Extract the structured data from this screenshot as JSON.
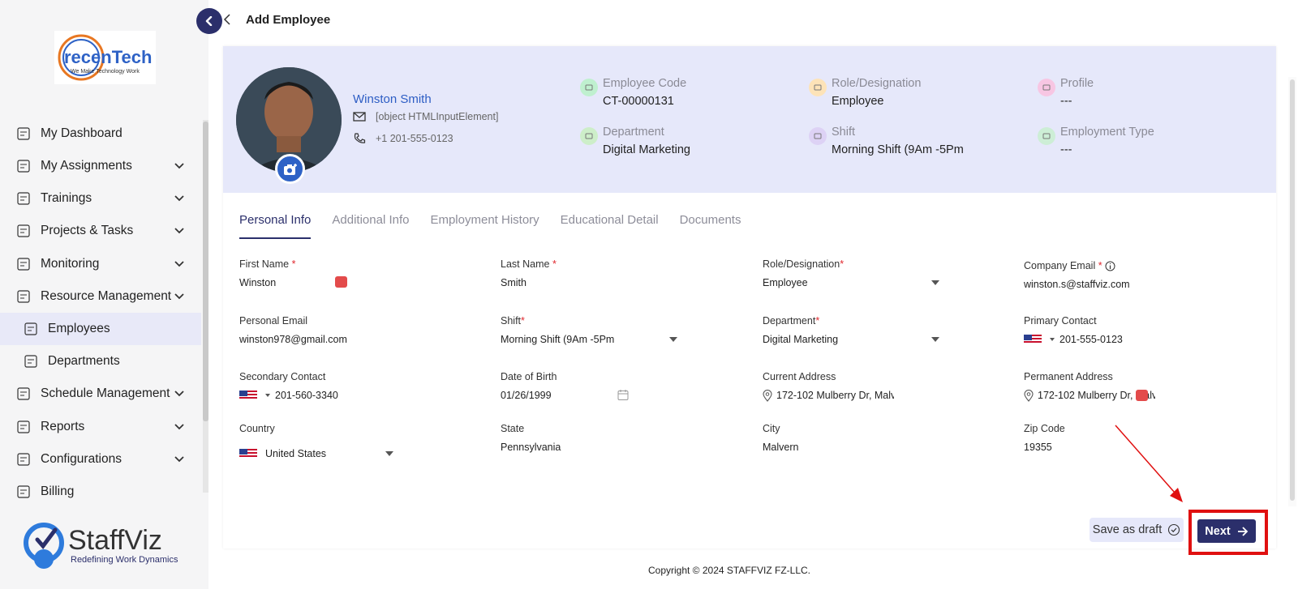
{
  "app": {
    "logo_text": "recenTech",
    "logo_tagline": "We Make Technology Work",
    "brand_name": "StaffViz",
    "brand_tagline": "Redefining Work Dynamics"
  },
  "sidebar": {
    "items": [
      {
        "label": "My Dashboard",
        "icon": "dashboard-icon",
        "expandable": false
      },
      {
        "label": "My Assignments",
        "icon": "assignments-icon",
        "expandable": true
      },
      {
        "label": "Trainings",
        "icon": "play-icon",
        "expandable": true
      },
      {
        "label": "Projects & Tasks",
        "icon": "clipboard-icon",
        "expandable": true
      },
      {
        "label": "Monitoring",
        "icon": "monitoring-icon",
        "expandable": true
      },
      {
        "label": "Resource Management",
        "icon": "resource-icon",
        "expandable": true
      },
      {
        "label": "Employees",
        "icon": "employee-icon",
        "expandable": false,
        "active": true
      },
      {
        "label": "Departments",
        "icon": "hierarchy-icon",
        "expandable": false
      },
      {
        "label": "Schedule Management",
        "icon": "calendar-icon",
        "expandable": true
      },
      {
        "label": "Reports",
        "icon": "report-icon",
        "expandable": true
      },
      {
        "label": "Configurations",
        "icon": "gear-icon",
        "expandable": true
      },
      {
        "label": "Billing",
        "icon": "billing-icon",
        "expandable": false
      }
    ]
  },
  "header": {
    "title": "Add Employee"
  },
  "profile": {
    "name": "Winston Smith",
    "email": "[object HTMLInputElement]",
    "phone": "+1 201-555-0123",
    "stats": [
      {
        "label": "Employee Code",
        "value": "CT-00000131",
        "color": "#bff0cf"
      },
      {
        "label": "Role/Designation",
        "value": "Employee",
        "color": "#fde3b8"
      },
      {
        "label": "Profile",
        "value": "---",
        "color": "#f7c6e3"
      },
      {
        "label": "Department",
        "value": "Digital Marketing",
        "color": "#cdeec9"
      },
      {
        "label": "Shift",
        "value": "Morning Shift (9Am -5Pm",
        "color": "#ddd2f5"
      },
      {
        "label": "Employment Type",
        "value": "---",
        "color": "#cdeed6"
      }
    ]
  },
  "tabs": [
    "Personal Info",
    "Additional Info",
    "Employment History",
    "Educational Detail",
    "Documents"
  ],
  "form": {
    "first_name": {
      "label": "First Name",
      "value": "Winston"
    },
    "last_name": {
      "label": "Last Name",
      "value": "Smith"
    },
    "role": {
      "label": "Role/Designation",
      "value": "Employee"
    },
    "company_email": {
      "label": "Company Email",
      "value": "winston.s@staffviz.com"
    },
    "personal_email": {
      "label": "Personal Email",
      "value": "winston978@gmail.com"
    },
    "shift": {
      "label": "Shift",
      "value": "Morning Shift (9Am -5Pm"
    },
    "department": {
      "label": "Department",
      "value": "Digital Marketing"
    },
    "primary_contact": {
      "label": "Primary Contact",
      "value": "201-555-0123"
    },
    "secondary_contact": {
      "label": "Secondary Contact",
      "value": "201-560-3340"
    },
    "dob": {
      "label": "Date of Birth",
      "value": "01/26/1999"
    },
    "current_address": {
      "label": "Current Address",
      "value": "172-102 Mulberry Dr, Malv"
    },
    "permanent_address": {
      "label": "Permanent Address",
      "value": "172-102 Mulberry Dr, Malv"
    },
    "country": {
      "label": "Country",
      "value": "United States"
    },
    "state": {
      "label": "State",
      "value": "Pennsylvania"
    },
    "city": {
      "label": "City",
      "value": "Malvern"
    },
    "zip": {
      "label": "Zip Code",
      "value": "19355"
    },
    "required_mark": "*"
  },
  "actions": {
    "save_draft": "Save as draft",
    "next": "Next"
  },
  "footer": {
    "copyright": "Copyright © 2024 STAFFVIZ FZ-LLC."
  },
  "colors": {
    "accent": "#2b2f6b",
    "banner": "#e6e8fa",
    "link": "#2d5dc4",
    "highlight": "#e01010"
  }
}
